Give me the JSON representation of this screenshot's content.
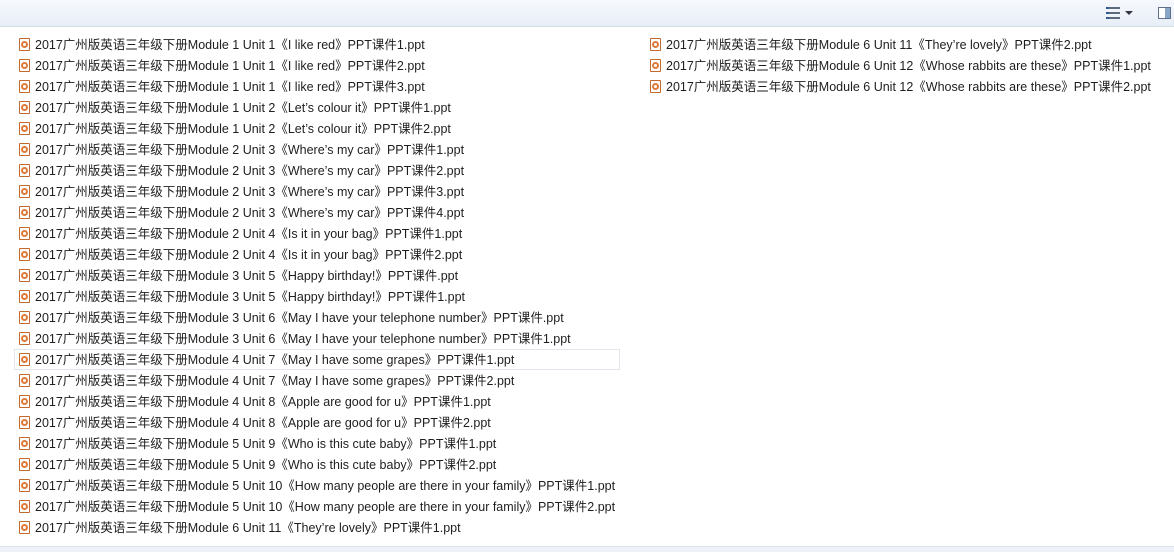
{
  "toolbar": {
    "view_icon": "view-options-icon",
    "dropdown_icon": "chevron-down-icon",
    "preview_icon": "preview-pane-icon"
  },
  "files": {
    "column1": [
      "2017广州版英语三年级下册Module 1 Unit 1《I like red》PPT课件1.ppt",
      "2017广州版英语三年级下册Module 1 Unit 1《I like red》PPT课件2.ppt",
      "2017广州版英语三年级下册Module 1 Unit 1《I like red》PPT课件3.ppt",
      "2017广州版英语三年级下册Module 1 Unit 2《Let’s colour it》PPT课件1.ppt",
      "2017广州版英语三年级下册Module 1 Unit 2《Let’s colour it》PPT课件2.ppt",
      "2017广州版英语三年级下册Module 2 Unit 3《Where’s my car》PPT课件1.ppt",
      "2017广州版英语三年级下册Module 2 Unit 3《Where’s my car》PPT课件2.ppt",
      "2017广州版英语三年级下册Module 2 Unit 3《Where’s my car》PPT课件3.ppt",
      "2017广州版英语三年级下册Module 2 Unit 3《Where’s my car》PPT课件4.ppt",
      "2017广州版英语三年级下册Module 2 Unit 4《Is it in your bag》PPT课件1.ppt",
      "2017广州版英语三年级下册Module 2 Unit 4《Is it in your bag》PPT课件2.ppt",
      "2017广州版英语三年级下册Module 3 Unit 5《Happy birthday!》PPT课件.ppt",
      "2017广州版英语三年级下册Module 3 Unit 5《Happy birthday!》PPT课件1.ppt",
      "2017广州版英语三年级下册Module 3 Unit 6《May I have your telephone number》PPT课件.ppt",
      "2017广州版英语三年级下册Module 3 Unit 6《May I have your telephone number》PPT课件1.ppt",
      "2017广州版英语三年级下册Module 4 Unit 7《May I have some grapes》PPT课件1.ppt",
      "2017广州版英语三年级下册Module 4 Unit 7《May I have some grapes》PPT课件2.ppt",
      "2017广州版英语三年级下册Module 4 Unit 8《Apple are good for u》PPT课件1.ppt",
      "2017广州版英语三年级下册Module 4 Unit 8《Apple are good for u》PPT课件2.ppt",
      "2017广州版英语三年级下册Module 5 Unit 9《Who is this cute baby》PPT课件1.ppt",
      "2017广州版英语三年级下册Module 5 Unit 9《Who is this cute baby》PPT课件2.ppt",
      "2017广州版英语三年级下册Module 5 Unit 10《How many people are there in your family》PPT课件1.ppt",
      "2017广州版英语三年级下册Module 5 Unit 10《How many people are there in your family》PPT课件2.ppt",
      "2017广州版英语三年级下册Module 6 Unit 11《They’re lovely》PPT课件1.ppt"
    ],
    "column2": [
      "2017广州版英语三年级下册Module 6 Unit 11《They’re lovely》PPT课件2.ppt",
      "2017广州版英语三年级下册Module 6 Unit 12《Whose rabbits are these》PPT课件1.ppt",
      "2017广州版英语三年级下册Module 6 Unit 12《Whose rabbits are these》PPT课件2.ppt"
    ],
    "file_icon": "powerpoint-file-icon",
    "focused_index": 15
  }
}
